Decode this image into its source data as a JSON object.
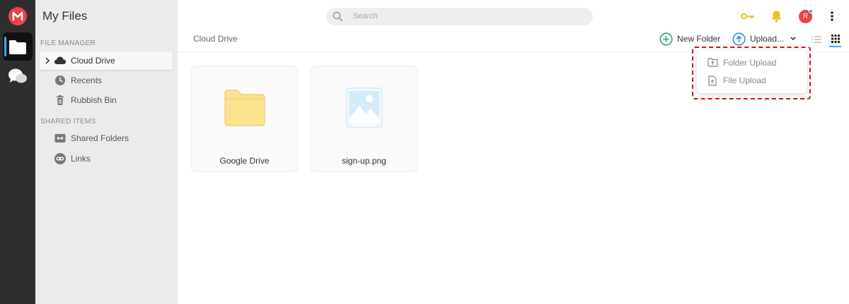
{
  "app": {
    "title": "My Files",
    "logo_letter": "M"
  },
  "sidebar": {
    "sections": [
      {
        "label": "FILE MANAGER"
      },
      {
        "label": "SHARED ITEMS"
      }
    ],
    "items": [
      {
        "label": "Cloud Drive",
        "icon": "cloud-icon"
      },
      {
        "label": "Recents",
        "icon": "clock-icon"
      },
      {
        "label": "Rubbish Bin",
        "icon": "trash-icon"
      },
      {
        "label": "Shared Folders",
        "icon": "shared-folder-icon"
      },
      {
        "label": "Links",
        "icon": "link-icon"
      }
    ]
  },
  "search": {
    "placeholder": "Search"
  },
  "header": {
    "avatar_initial": "R"
  },
  "breadcrumb": {
    "current": "Cloud Drive"
  },
  "toolbar": {
    "new_folder_label": "New Folder",
    "upload_label": "Upload..."
  },
  "files": [
    {
      "name": "Google Drive",
      "type": "folder"
    },
    {
      "name": "sign-up.png",
      "type": "image"
    }
  ],
  "upload_menu": {
    "items": [
      {
        "label": "Folder Upload",
        "icon": "folder-upload-icon"
      },
      {
        "label": "File Upload",
        "icon": "file-upload-icon"
      }
    ]
  },
  "colors": {
    "brand": "#e9404d",
    "accent": "#3fa8ff",
    "new_folder_green": "#27a56a",
    "upload_blue": "#2f8fd8",
    "key_gold": "#f0c020",
    "highlight_red": "#d6101a"
  }
}
